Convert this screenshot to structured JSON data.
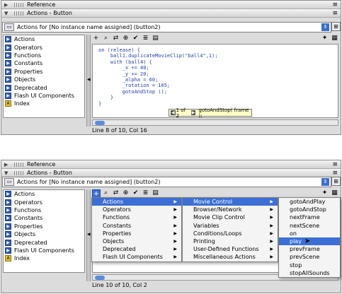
{
  "panels": [
    {
      "reference_label": "Reference",
      "actions_label": "Actions - Button",
      "target": "Actions for [No instance name assigned]  (button2)",
      "toolbox": [
        "Actions",
        "Operators",
        "Functions",
        "Constants",
        "Properties",
        "Objects",
        "Deprecated",
        "Flash UI Components",
        "Index"
      ],
      "code": [
        "on (release) {",
        "    ball1.duplicateMovieClip(\"ball4\",1);",
        "    with (ball4) {",
        "        _x += 40;",
        "        _y += 20;",
        "        _alpha = 60;",
        "        _rotation = 105;",
        "        gotoAndStop ();",
        "    }",
        "}"
      ],
      "hint": {
        "counter": "1 of 2",
        "text": "gotoAndStop( frame );"
      },
      "status": "Line 8 of 10, Col 16"
    },
    {
      "reference_label": "Reference",
      "actions_label": "Actions - Button",
      "target": "Actions for [No instance name assigned]  (button2)",
      "toolbox": [
        "Actions",
        "Operators",
        "Functions",
        "Constants",
        "Properties",
        "Objects",
        "Deprecated",
        "Flash UI Components",
        "Index"
      ],
      "status": "Line 10 of 10, Col 2"
    }
  ],
  "menus": {
    "level1": [
      "Actions",
      "Operators",
      "Functions",
      "Constants",
      "Properties",
      "Objects",
      "Deprecated",
      "Flash UI Components"
    ],
    "level2": [
      "Movie Control",
      "Browser/Network",
      "Movie Clip Control",
      "Variables",
      "Conditions/Loops",
      "Printing",
      "User-Defined Functions",
      "Miscellaneous Actions"
    ],
    "level3": [
      "gotoAndPlay",
      "gotoAndStop",
      "nextFrame",
      "nextScene",
      "on",
      "play",
      "prevFrame",
      "prevScene",
      "stop",
      "stopAllSounds"
    ]
  },
  "selected": {
    "level1": "Actions",
    "level2": "Movie Control",
    "level3": "play"
  },
  "colors": {
    "selection": "#3b6fd6",
    "code": "#1f3fa8",
    "hint_bg": "#ffffc6"
  },
  "icons": {
    "book": "book-icon",
    "index": "index-icon",
    "add": "plus-icon"
  }
}
